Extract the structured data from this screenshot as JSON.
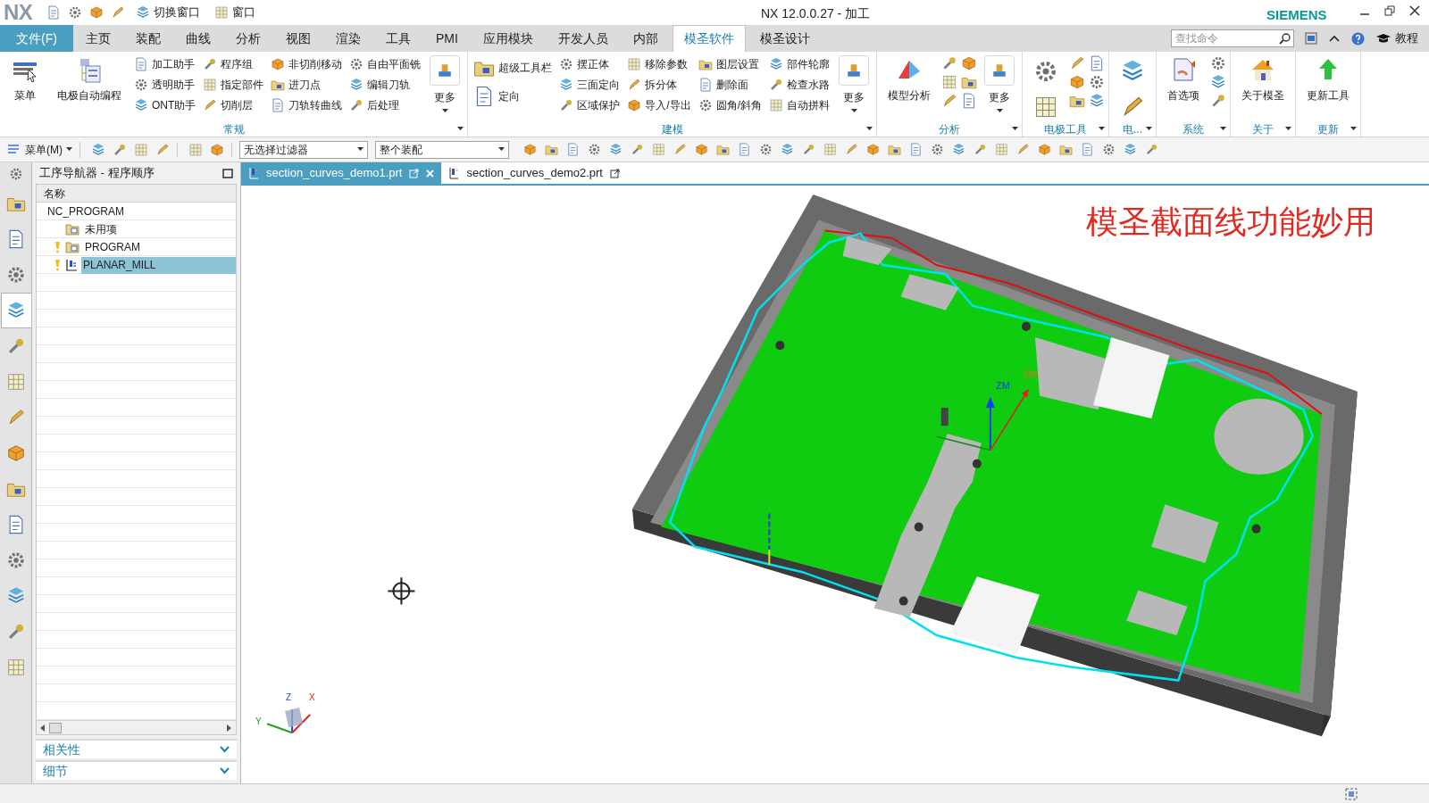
{
  "app": {
    "logo": "NX",
    "title": "NX 12.0.0.27 - 加工",
    "brand": "SIEMENS"
  },
  "quick_access": [
    {
      "label": "切换窗口"
    },
    {
      "label": "窗口"
    }
  ],
  "menu_tabs": [
    {
      "label": "文件(F)",
      "kind": "file",
      "selected": false
    },
    {
      "label": "主页",
      "kind": "tab",
      "selected": false
    },
    {
      "label": "装配",
      "kind": "tab",
      "selected": false
    },
    {
      "label": "曲线",
      "kind": "tab",
      "selected": false
    },
    {
      "label": "分析",
      "kind": "tab",
      "selected": false
    },
    {
      "label": "视图",
      "kind": "tab",
      "selected": false
    },
    {
      "label": "渲染",
      "kind": "tab",
      "selected": false
    },
    {
      "label": "工具",
      "kind": "tab",
      "selected": false
    },
    {
      "label": "PMI",
      "kind": "tab",
      "selected": false
    },
    {
      "label": "应用模块",
      "kind": "tab",
      "selected": false
    },
    {
      "label": "开发人员",
      "kind": "tab",
      "selected": false
    },
    {
      "label": "内部",
      "kind": "tab",
      "selected": false
    },
    {
      "label": "模圣软件",
      "kind": "tab",
      "selected": true
    },
    {
      "label": "模圣设计",
      "kind": "tab",
      "selected": false
    }
  ],
  "search": {
    "placeholder": "查找命令"
  },
  "tutorial": "教程",
  "ribbon_groups": [
    {
      "title": "常规",
      "items": [
        {
          "kind": "large",
          "label": "菜单"
        },
        {
          "kind": "large",
          "label": "电极自动编程"
        },
        {
          "kind": "small",
          "label": "加工助手"
        },
        {
          "kind": "small",
          "label": "透明助手"
        },
        {
          "kind": "small",
          "label": "ONT助手"
        },
        {
          "kind": "small",
          "label": "程序组"
        },
        {
          "kind": "small",
          "label": "指定部件"
        },
        {
          "kind": "small",
          "label": "切削层"
        },
        {
          "kind": "small",
          "label": "非切削移动"
        },
        {
          "kind": "small",
          "label": "进刀点"
        },
        {
          "kind": "small",
          "label": "刀轨转曲线"
        },
        {
          "kind": "small",
          "label": "自由平面铣"
        },
        {
          "kind": "small",
          "label": "编辑刀轨"
        },
        {
          "kind": "small",
          "label": "后处理"
        },
        {
          "kind": "more",
          "label": "更多"
        }
      ]
    },
    {
      "title": "建模",
      "items": [
        {
          "kind": "medium",
          "label": "超级工具栏"
        },
        {
          "kind": "medium",
          "label": "定向"
        },
        {
          "kind": "small",
          "label": "摆正体"
        },
        {
          "kind": "small",
          "label": "三面定向"
        },
        {
          "kind": "small",
          "label": "区域保护"
        },
        {
          "kind": "small",
          "label": "移除参数"
        },
        {
          "kind": "small",
          "label": "拆分体"
        },
        {
          "kind": "small",
          "label": "导入/导出"
        },
        {
          "kind": "small",
          "label": "图层设置"
        },
        {
          "kind": "small",
          "label": "删除面"
        },
        {
          "kind": "small",
          "label": "圆角/斜角"
        },
        {
          "kind": "small",
          "label": "部件轮廓"
        },
        {
          "kind": "small",
          "label": "检查水路"
        },
        {
          "kind": "small",
          "label": "自动拼料"
        },
        {
          "kind": "more",
          "label": "更多"
        }
      ]
    },
    {
      "title": "分析",
      "items": [
        {
          "kind": "large",
          "label": "模型分析"
        },
        {
          "kind": "icon"
        },
        {
          "kind": "icon"
        },
        {
          "kind": "icon"
        },
        {
          "kind": "icon"
        },
        {
          "kind": "icon"
        },
        {
          "kind": "icon"
        },
        {
          "kind": "more",
          "label": "更多"
        }
      ]
    },
    {
      "title": "电极工具",
      "items": [
        {
          "kind": "bigicon"
        },
        {
          "kind": "icon"
        },
        {
          "kind": "icon"
        },
        {
          "kind": "icon"
        },
        {
          "kind": "icon"
        },
        {
          "kind": "icon"
        },
        {
          "kind": "icon"
        }
      ]
    },
    {
      "title": "电...",
      "items": [
        {
          "kind": "bigicon"
        }
      ]
    },
    {
      "title": "系统",
      "items": [
        {
          "kind": "large",
          "label": "首选项"
        },
        {
          "kind": "icon"
        },
        {
          "kind": "icon"
        },
        {
          "kind": "icon"
        }
      ]
    },
    {
      "title": "关于",
      "items": [
        {
          "kind": "large",
          "label": "关于模圣"
        }
      ]
    },
    {
      "title": "更新",
      "items": [
        {
          "kind": "large",
          "label": "更新工具"
        }
      ]
    }
  ],
  "toolbar": {
    "menu": "菜单(M)",
    "filters": [
      {
        "value": "无选择过滤器"
      },
      {
        "value": "整个装配"
      }
    ]
  },
  "resource_bar": [
    {
      "selected": false
    },
    {
      "selected": false
    },
    {
      "selected": false
    },
    {
      "selected": true
    },
    {
      "selected": false
    },
    {
      "selected": false
    },
    {
      "selected": false
    },
    {
      "selected": false
    },
    {
      "selected": false
    },
    {
      "selected": false
    },
    {
      "selected": false
    },
    {
      "selected": false
    },
    {
      "selected": false
    },
    {
      "selected": false
    }
  ],
  "navigator": {
    "title": "工序导航器 - 程序顺序",
    "column": "名称",
    "tree": [
      {
        "label": "NC_PROGRAM",
        "warning": false,
        "selected": false,
        "children": [
          {
            "label": "未用项",
            "kind": "group",
            "warning": false,
            "selected": false
          },
          {
            "label": "PROGRAM",
            "kind": "group",
            "warning": true,
            "selected": false
          },
          {
            "label": "PLANAR_MILL",
            "kind": "operation",
            "warning": true,
            "selected": true
          }
        ]
      }
    ]
  },
  "panels": [
    {
      "label": "相关性",
      "expanded": false
    },
    {
      "label": "细节",
      "expanded": false
    }
  ],
  "documents": [
    {
      "name": "section_curves_demo1.prt",
      "selected": true
    },
    {
      "name": "section_curves_demo2.prt",
      "selected": false
    }
  ],
  "viewport": {
    "overlay_title": "模圣截面线功能妙用",
    "axis_labels": [
      "ZM",
      "XM"
    ],
    "triad_labels": [
      "Y",
      "Z",
      "X"
    ]
  }
}
